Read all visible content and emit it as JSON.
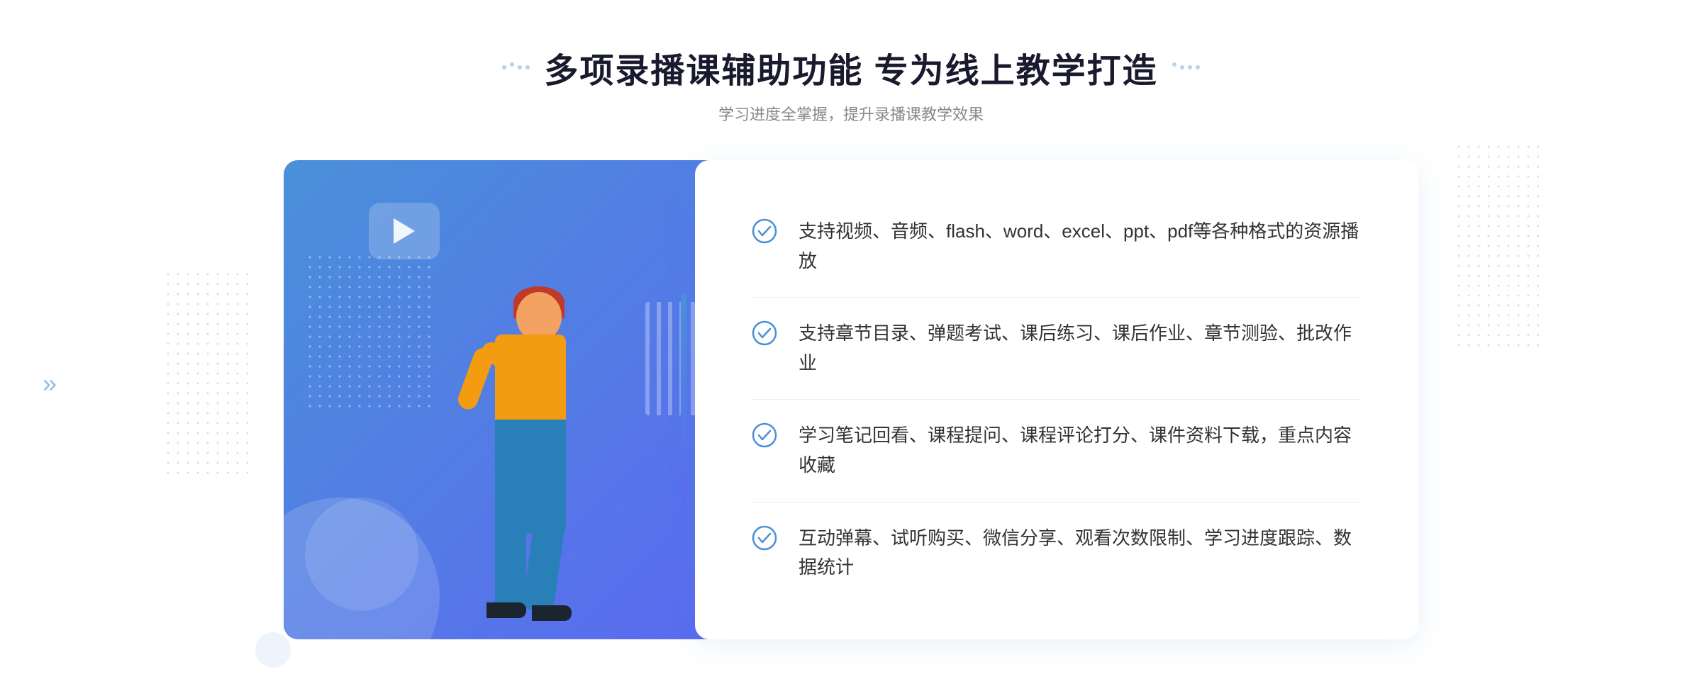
{
  "header": {
    "main_title": "多项录播课辅助功能 专为线上教学打造",
    "subtitle": "学习进度全掌握，提升录播课教学效果"
  },
  "features": [
    {
      "id": "feature-1",
      "text": "支持视频、音频、flash、word、excel、ppt、pdf等各种格式的资源播放"
    },
    {
      "id": "feature-2",
      "text": "支持章节目录、弹题考试、课后练习、课后作业、章节测验、批改作业"
    },
    {
      "id": "feature-3",
      "text": "学习笔记回看、课程提问、课程评论打分、课件资料下载，重点内容收藏"
    },
    {
      "id": "feature-4",
      "text": "互动弹幕、试听购买、微信分享、观看次数限制、学习进度跟踪、数据统计"
    }
  ],
  "colors": {
    "primary": "#4a90d9",
    "secondary": "#5b6af0",
    "text_dark": "#1a1a2e",
    "text_gray": "#888",
    "text_body": "#333"
  }
}
